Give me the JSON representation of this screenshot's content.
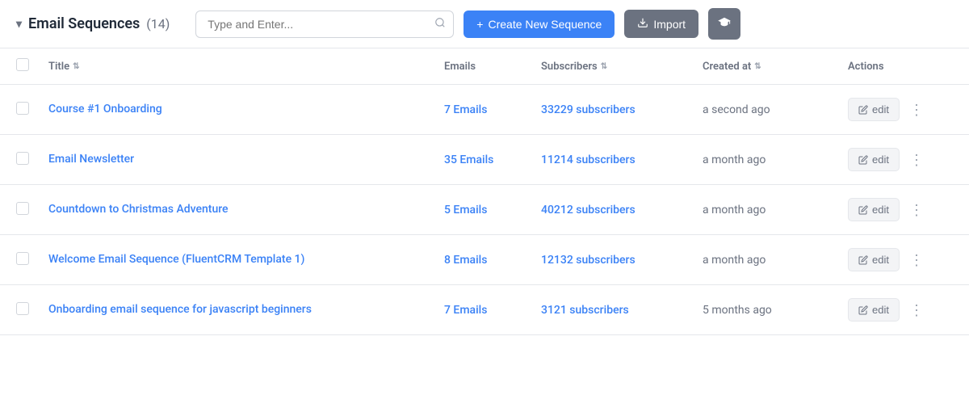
{
  "header": {
    "chevron": "▾",
    "title": "Email Sequences",
    "count": "(14)",
    "search_placeholder": "Type and Enter...",
    "create_label": "Create New Sequence",
    "import_label": "Import",
    "flag_icon": "🎓"
  },
  "table": {
    "columns": {
      "title": "Title",
      "emails": "Emails",
      "subscribers": "Subscribers",
      "created_at": "Created at",
      "actions": "Actions"
    },
    "rows": [
      {
        "title": "Course #1 Onboarding",
        "emails": "7 Emails",
        "subscribers": "33229 subscribers",
        "created_at": "a second ago"
      },
      {
        "title": "Email Newsletter",
        "emails": "35 Emails",
        "subscribers": "11214 subscribers",
        "created_at": "a month ago"
      },
      {
        "title": "Countdown to Christmas Adventure",
        "emails": "5 Emails",
        "subscribers": "40212 subscribers",
        "created_at": "a month ago"
      },
      {
        "title": "Welcome Email Sequence (FluentCRM Template 1)",
        "emails": "8 Emails",
        "subscribers": "12132 subscribers",
        "created_at": "a month ago"
      },
      {
        "title": "Onboarding email sequence for javascript beginners",
        "emails": "7 Emails",
        "subscribers": "3121 subscribers",
        "created_at": "5 months ago"
      }
    ],
    "edit_label": "edit"
  }
}
